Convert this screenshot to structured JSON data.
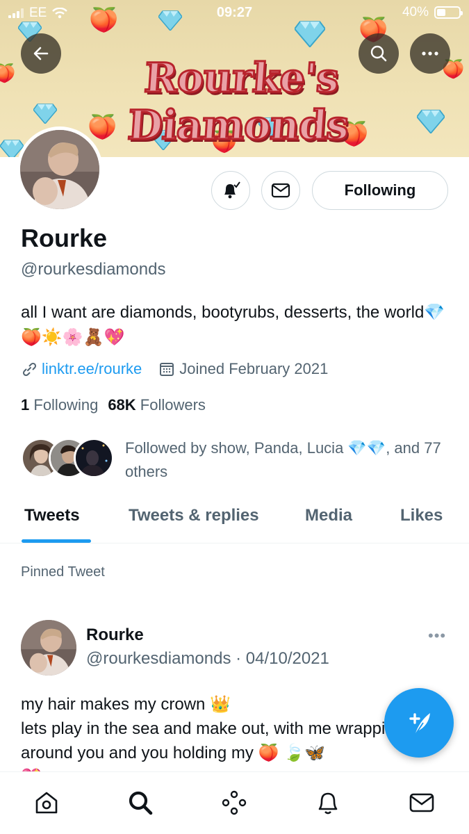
{
  "status_bar": {
    "carrier": "EE",
    "time": "09:27",
    "battery": "40%",
    "battery_level": 0.4
  },
  "banner": {
    "title": "Rourke's Diamonds"
  },
  "icons": {
    "back": "arrow-left-icon",
    "search": "search-icon",
    "more": "more-horizontal-icon",
    "notify": "bell-check-icon",
    "message": "mail-icon",
    "link": "link-icon",
    "calendar": "calendar-icon",
    "compose": "feather-plus-icon",
    "home": "home-icon",
    "explore": "search-icon",
    "spaces": "spaces-icon",
    "notifications": "bell-icon",
    "messages": "mail-icon"
  },
  "profile": {
    "name": "Rourke",
    "handle": "@rourkesdiamonds",
    "bio": "all I want are diamonds, bootyrubs, desserts, the world💎🍑☀️🌸🧸💖",
    "website": "linktr.ee/rourke",
    "joined": "Joined February 2021",
    "following_count": "1",
    "following_label": "Following",
    "followers_count": "68K",
    "followers_label": "Followers",
    "followed_by": "Followed by show, Panda, Lucia 💎💎, and 77 others",
    "follow_button": "Following"
  },
  "tabs": [
    "Tweets",
    "Tweets & replies",
    "Media",
    "Likes"
  ],
  "active_tab": "Tweets",
  "pinned_label": "Pinned Tweet",
  "tweet": {
    "name": "Rourke",
    "handle_date": "@rourkesdiamonds · 04/10/2021",
    "more": "•••",
    "text_line1": "my hair makes my crown 👑",
    "text_line2": "lets play in the sea and make out, with me wrapping around you and you holding my 🍑 🍃🦋",
    "text_line3": "💖"
  },
  "colors": {
    "accent": "#1d9bf0",
    "text": "#0f1419",
    "secondary": "#536471",
    "banner_bg": "#eee0b4",
    "banner_title": "#c0262f"
  }
}
